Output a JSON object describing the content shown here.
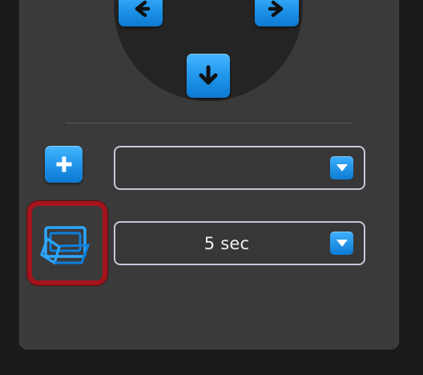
{
  "dropdowns": {
    "top_value": "",
    "bottom_value": "5 sec"
  },
  "icons": {
    "left_arrow": "arrow-left-icon",
    "right_arrow": "arrow-right-icon",
    "down_arrow": "arrow-down-icon",
    "add": "plus-icon",
    "window_toggle": "windows-overlap-icon",
    "dropdown": "chevron-down-icon"
  },
  "colors": {
    "background": "#1b1b1b",
    "panel": "#3a3a3a",
    "dpad": "#242424",
    "accent_blue": "#1f95ea",
    "outline": "#c3c9d8",
    "highlight_red": "#a3141c"
  }
}
